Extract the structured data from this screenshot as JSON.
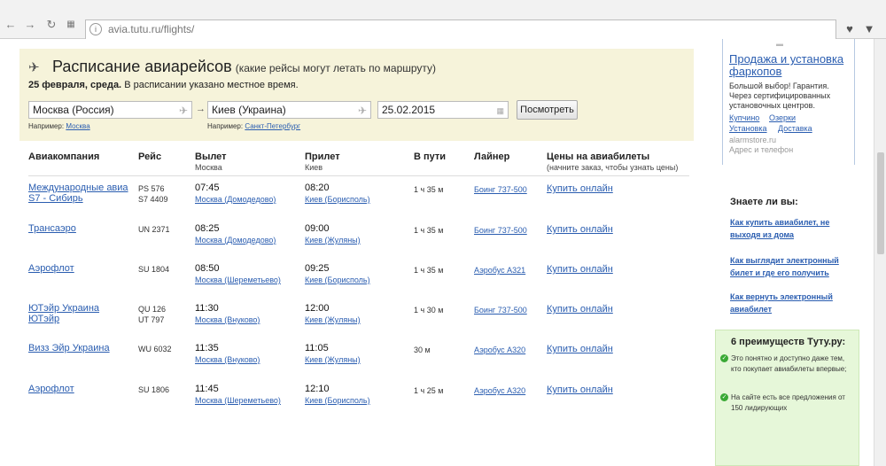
{
  "browser": {
    "url": "avia.tutu.ru/flights/"
  },
  "search": {
    "title": "Расписание авиарейсов",
    "subtitle": "(какие рейсы могут летать по маршруту)",
    "date_bold": "25 февраля, среда.",
    "date_note": "В расписании указано местное время.",
    "from": "Москва (Россия)",
    "to": "Киев (Украина)",
    "date": "25.02.2015",
    "show_button": "Посмотреть",
    "hint_label": "Например:",
    "hint_from": "Москва",
    "hint_to": "Санкт-Петербург"
  },
  "table": {
    "headers": {
      "airline": "Авиакомпания",
      "flight": "Рейс",
      "departure": "Вылет",
      "departure_sub": "Москва",
      "arrival": "Прилет",
      "arrival_sub": "Киев",
      "duration": "В пути",
      "plane": "Лайнер",
      "price": "Цены на авиабилеты",
      "price_sub": "(начните заказ, чтобы узнать цены)"
    },
    "rows": [
      {
        "airline1": "Международные авиа",
        "airline2": "S7 - Сибирь",
        "flight1": "PS 576",
        "flight2": "S7 4409",
        "dep_time": "07:45",
        "dep_place": "Москва (Домодедово)",
        "arr_time": "08:20",
        "arr_place": "Киев (Борисполь)",
        "duration": "1 ч 35 м",
        "plane": "Боинг 737-500",
        "buy": "Купить онлайн"
      },
      {
        "airline1": "Трансаэро",
        "airline2": "",
        "flight1": "UN 2371",
        "flight2": "",
        "dep_time": "08:25",
        "dep_place": "Москва (Домодедово)",
        "arr_time": "09:00",
        "arr_place": "Киев (Жуляны)",
        "duration": "1 ч 35 м",
        "plane": "Боинг 737-500",
        "buy": "Купить онлайн"
      },
      {
        "airline1": "Аэрофлот",
        "airline2": "",
        "flight1": "SU 1804",
        "flight2": "",
        "dep_time": "08:50",
        "dep_place": "Москва (Шереметьево)",
        "arr_time": "09:25",
        "arr_place": "Киев (Борисполь)",
        "duration": "1 ч 35 м",
        "plane": "Аэробус A321",
        "buy": "Купить онлайн"
      },
      {
        "airline1": "ЮТэйр Украина",
        "airline2": "ЮТэйр",
        "flight1": "QU 126",
        "flight2": "UT 797",
        "dep_time": "11:30",
        "dep_place": "Москва (Внуково)",
        "arr_time": "12:00",
        "arr_place": "Киев (Жуляны)",
        "duration": "1 ч 30 м",
        "plane": "Боинг 737-500",
        "buy": "Купить онлайн"
      },
      {
        "airline1": "Визз Эйр Украина",
        "airline2": "",
        "flight1": "WU 6032",
        "flight2": "",
        "dep_time": "11:35",
        "dep_place": "Москва (Внуково)",
        "arr_time": "11:05",
        "arr_place": "Киев (Жуляны)",
        "duration": "30 м",
        "plane": "Аэробус A320",
        "buy": "Купить онлайн"
      },
      {
        "airline1": "Аэрофлот",
        "airline2": "",
        "flight1": "SU 1806",
        "flight2": "",
        "dep_time": "11:45",
        "dep_place": "Москва (Шереметьево)",
        "arr_time": "12:10",
        "arr_place": "Киев (Борисполь)",
        "duration": "1 ч 25 м",
        "plane": "Аэробус A320",
        "buy": "Купить онлайн"
      }
    ]
  },
  "ad": {
    "title": "Продажа и установка фаркопов",
    "text": "Большой выбор! Гарантия. Через сертифицированных установочных центров.",
    "links": [
      "Купчино",
      "Озерки",
      "Установка",
      "Доставка"
    ],
    "domain": "alarmstore.ru",
    "sub": "Адрес и телефон"
  },
  "know": {
    "title": "Знаете ли вы:",
    "links": [
      "Как купить авиабилет, не выходя из дома",
      "Как выглядит электронный билет и где его получить",
      "Как вернуть электронный авиабилет"
    ]
  },
  "advantages": {
    "title": "6 преимуществ Tуту.ру:",
    "items": [
      "Это понятно и доступно даже тем, кто покупает авиабилеты впервые;",
      "На сайте есть все предложения от 150 лидирующих"
    ]
  },
  "colors": {
    "link": "#2a5db0",
    "panel": "#f6f3da",
    "advantages_bg": "#e6f7d9",
    "check": "#3aa935"
  }
}
